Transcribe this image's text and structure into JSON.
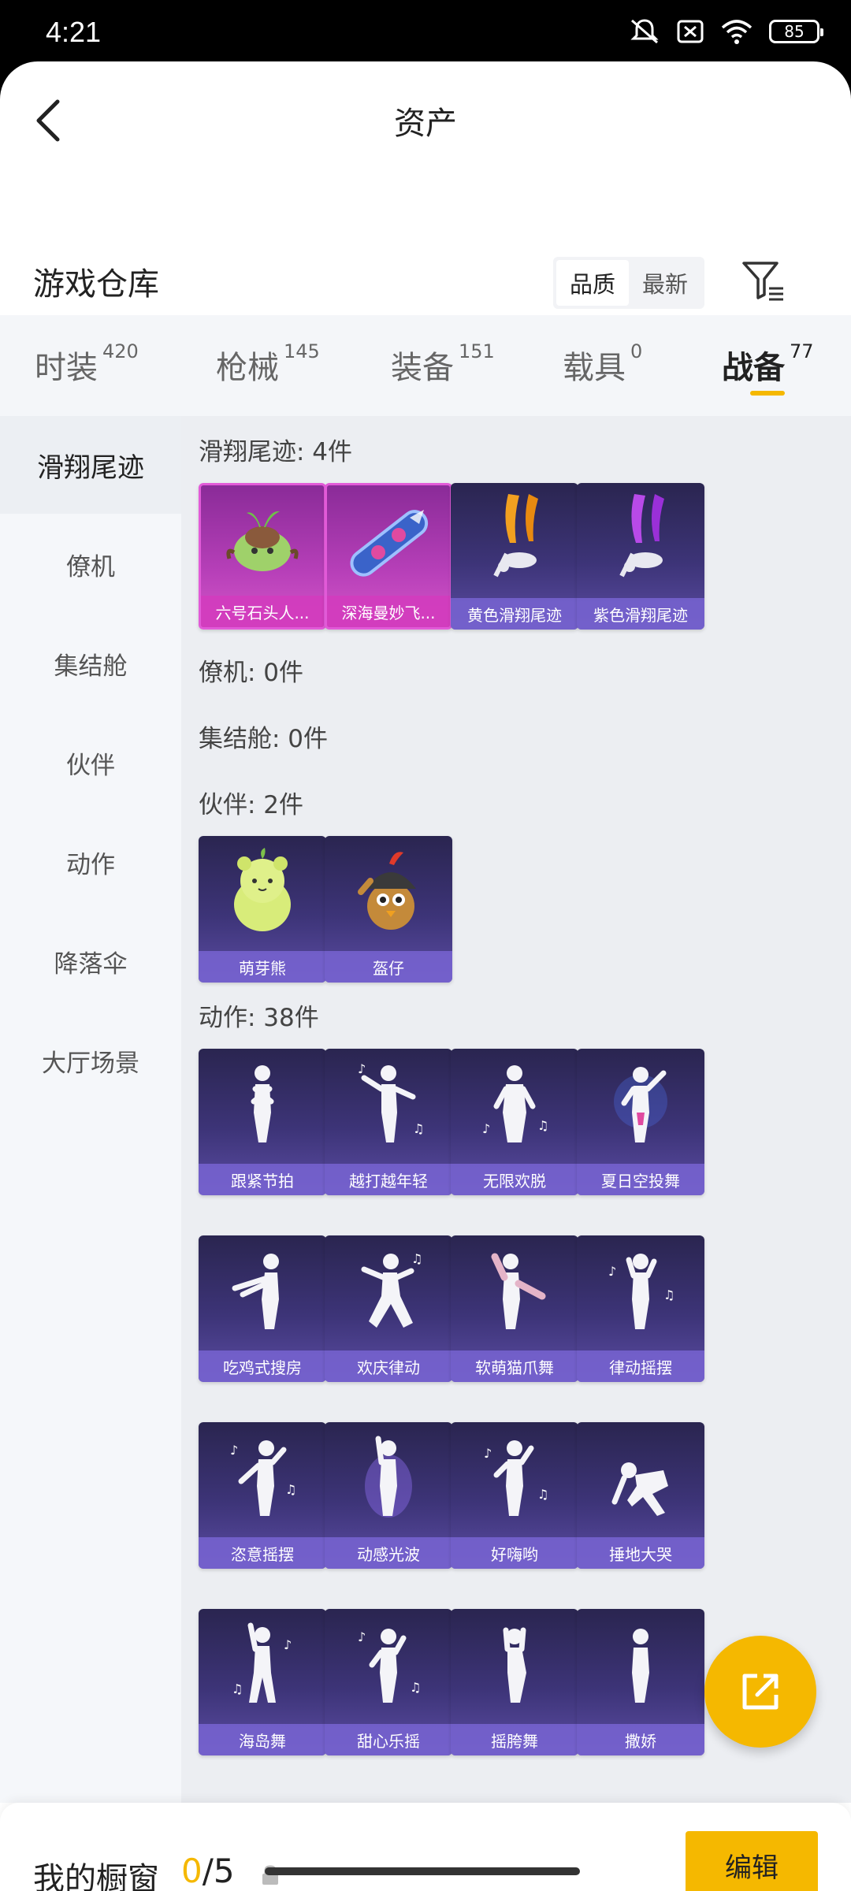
{
  "status": {
    "time": "4:21",
    "battery": "85"
  },
  "header": {
    "title": "资产"
  },
  "warehouse": {
    "title": "游戏仓库",
    "sort_options": [
      "品质",
      "最新"
    ],
    "active_sort": 0
  },
  "categories": [
    {
      "label": "时装",
      "count": "420"
    },
    {
      "label": "枪械",
      "count": "145"
    },
    {
      "label": "装备",
      "count": "151"
    },
    {
      "label": "载具",
      "count": "0"
    },
    {
      "label": "战备",
      "count": "77"
    }
  ],
  "nav": [
    "滑翔尾迹",
    "僚机",
    "集结舱",
    "伙伴",
    "动作",
    "降落伞",
    "大厅场景"
  ],
  "sections": {
    "glide": {
      "title": "滑翔尾迹: 4件",
      "items": [
        "六号石头人...",
        "深海曼妙飞...",
        "黄色滑翔尾迹",
        "紫色滑翔尾迹"
      ]
    },
    "wingman": {
      "title": "僚机: 0件"
    },
    "capsule": {
      "title": "集结舱: 0件"
    },
    "partner": {
      "title": "伙伴: 2件",
      "items": [
        "萌芽熊",
        "盔仔"
      ]
    },
    "emote": {
      "title": "动作: 38件",
      "items": [
        "跟紧节拍",
        "越打越年轻",
        "无限欢脱",
        "夏日空投舞",
        "吃鸡式搜房",
        "欢庆律动",
        "软萌猫爪舞",
        "律动摇摆",
        "恣意摇摆",
        "动感光波",
        "好嗨哟",
        "捶地大哭",
        "海岛舞",
        "甜心乐摇",
        "摇胯舞",
        "撒娇"
      ]
    }
  },
  "bottom": {
    "label": "我的橱窗",
    "current": "0",
    "total": "/5",
    "edit": "编辑"
  },
  "colors": {
    "accent": "#f5b800",
    "card_purple": "#3d3478",
    "card_pink": "#b63fb8"
  }
}
